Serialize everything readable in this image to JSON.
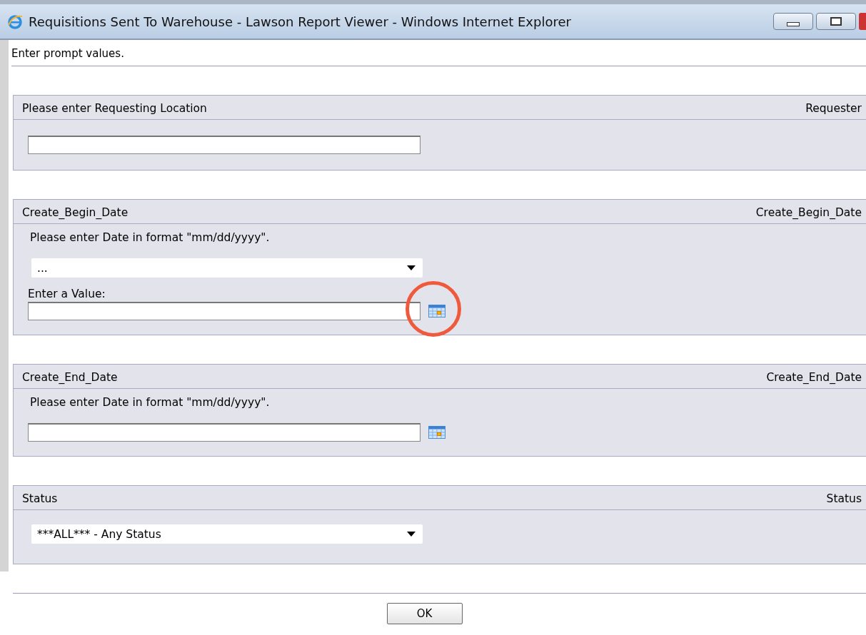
{
  "window": {
    "title": "Requisitions Sent To Warehouse - Lawson Report Viewer - Windows Internet Explorer"
  },
  "instruction": "Enter prompt values.",
  "sections": [
    {
      "kind": "text",
      "title": "Please enter Requesting Location",
      "title_right": "Requester"
    },
    {
      "kind": "date_choice",
      "title": "Create_Begin_Date",
      "title_right": "Create_Begin_Date",
      "hint": "Please enter Date in format \"mm/dd/yyyy\".",
      "select_value": "...",
      "value_label": "Enter a Value:",
      "calendar_highlighted": true
    },
    {
      "kind": "date",
      "title": "Create_End_Date",
      "title_right": "Create_End_Date",
      "hint": "Please enter Date in format \"mm/dd/yyyy\".",
      "calendar_highlighted": false
    },
    {
      "kind": "select",
      "title": "Status",
      "title_right": "Status",
      "select_value": "***ALL*** - Any Status"
    }
  ],
  "ok_button": "OK"
}
